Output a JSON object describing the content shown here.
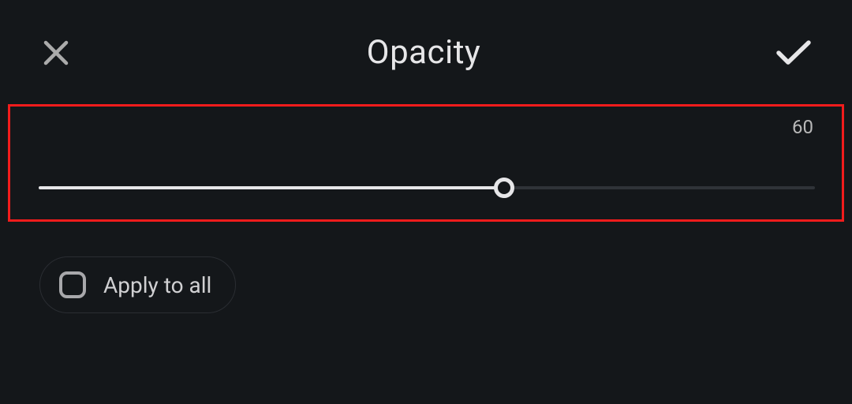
{
  "header": {
    "title": "Opacity"
  },
  "slider": {
    "value": "60",
    "percent": 60
  },
  "apply": {
    "label": "Apply to all"
  }
}
